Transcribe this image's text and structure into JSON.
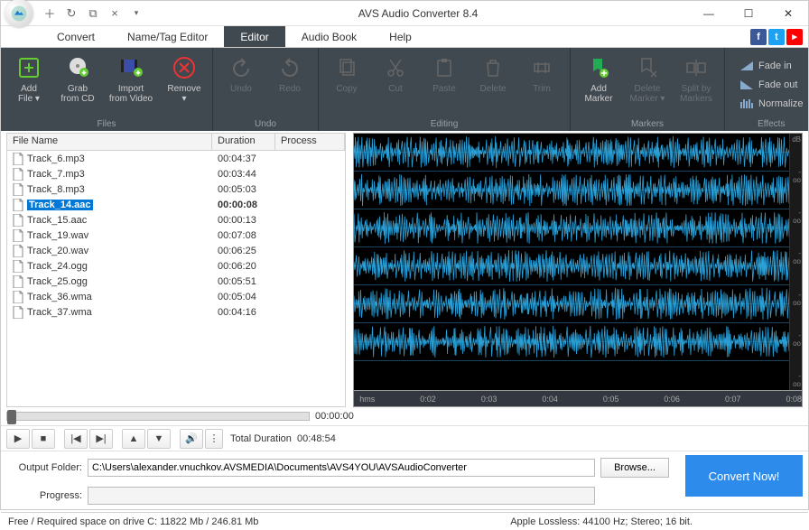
{
  "title": "AVS Audio Converter 8.4",
  "tabs": [
    "Convert",
    "Name/Tag Editor",
    "Editor",
    "Audio Book",
    "Help"
  ],
  "active_tab": 2,
  "ribbon": {
    "files": {
      "label": "Files",
      "add": "Add\nFile ▾",
      "grab": "Grab\nfrom CD",
      "import": "Import\nfrom Video",
      "remove": "Remove\n▾"
    },
    "undo": {
      "label": "Undo",
      "undo": "Undo",
      "redo": "Redo"
    },
    "editing": {
      "label": "Editing",
      "copy": "Copy",
      "cut": "Cut",
      "paste": "Paste",
      "delete": "Delete",
      "trim": "Trim"
    },
    "markers": {
      "label": "Markers",
      "add": "Add\nMarker",
      "delete": "Delete\nMarker ▾",
      "split": "Split by\nMarkers"
    },
    "effects": {
      "label": "Effects",
      "fadein": "Fade in",
      "fadeout": "Fade out",
      "normalize": "Normalize"
    }
  },
  "columns": {
    "file": "File Name",
    "duration": "Duration",
    "process": "Process"
  },
  "files": [
    {
      "name": "Track_6.mp3",
      "duration": "00:04:37"
    },
    {
      "name": "Track_7.mp3",
      "duration": "00:03:44"
    },
    {
      "name": "Track_8.mp3",
      "duration": "00:05:03"
    },
    {
      "name": "Track_14.aac",
      "duration": "00:00:08",
      "selected": true
    },
    {
      "name": "Track_15.aac",
      "duration": "00:00:13"
    },
    {
      "name": "Track_19.wav",
      "duration": "00:07:08"
    },
    {
      "name": "Track_20.wav",
      "duration": "00:06:25"
    },
    {
      "name": "Track_24.ogg",
      "duration": "00:06:20"
    },
    {
      "name": "Track_25.ogg",
      "duration": "00:05:51"
    },
    {
      "name": "Track_36.wma",
      "duration": "00:05:04"
    },
    {
      "name": "Track_37.wma",
      "duration": "00:04:16"
    }
  ],
  "waveform": {
    "db_label": "dB",
    "db_inf": "-oo",
    "axis_label": "hms",
    "ticks": [
      "0:02",
      "0:03",
      "0:04",
      "0:05",
      "0:06",
      "0:07",
      "0:08"
    ]
  },
  "seek_time": "00:00:00",
  "total_label": "Total Duration",
  "total_duration": "00:48:54",
  "output": {
    "folder_label": "Output Folder:",
    "folder": "C:\\Users\\alexander.vnuchkov.AVSMEDIA\\Documents\\AVS4YOU\\AVSAudioConverter",
    "browse": "Browse...",
    "progress_label": "Progress:",
    "convert": "Convert Now!"
  },
  "status": {
    "left": "Free / Required space on drive  C: 11822 Mb / 246.81 Mb",
    "right": "Apple Lossless: 44100  Hz; Stereo;  16 bit."
  }
}
